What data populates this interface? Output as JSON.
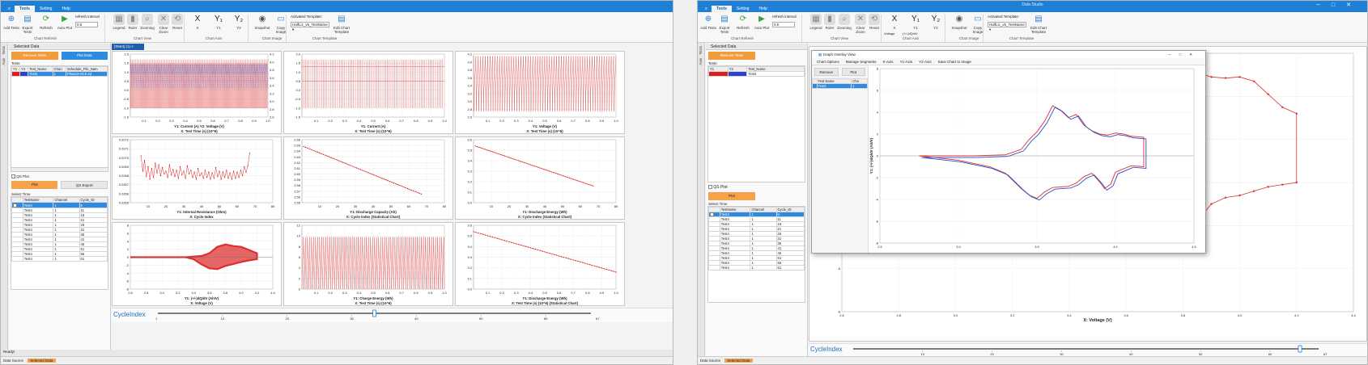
{
  "w1": {
    "file": "≡",
    "tabs": [
      "Tools",
      "Setting",
      "Help"
    ],
    "ribbon": {
      "buttons": [
        {
          "label": "Add Tests",
          "icon": "⊕",
          "color": "#2f7fd0"
        },
        {
          "label": "Export Tests",
          "icon": "▤",
          "color": "#2f7fd0"
        },
        {
          "label": "Refresh",
          "icon": "⟳",
          "color": "#3aa03a"
        },
        {
          "label": "Auto Plot",
          "icon": "▶",
          "color": "#3aa03a"
        },
        {
          "label": "Legend",
          "icon": "▦",
          "color": "#888"
        },
        {
          "label": "Ruler",
          "icon": "▮",
          "color": "#888"
        },
        {
          "label": "Zooming",
          "icon": "⌕",
          "color": "#888"
        },
        {
          "label": "Clear Zoom",
          "icon": "✕",
          "color": "#888"
        },
        {
          "label": "Reset",
          "icon": "⟲",
          "color": "#888"
        },
        {
          "label": "X",
          "icon": "X",
          "color": "#223"
        },
        {
          "label": "Y1",
          "icon": "Y₁",
          "color": "#223"
        },
        {
          "label": "Y2",
          "icon": "Y₂",
          "color": "#223"
        },
        {
          "label": "Snapshot",
          "icon": "◉",
          "color": "#555"
        },
        {
          "label": "Copy Image",
          "icon": "▭",
          "color": "#2f7fd0"
        },
        {
          "label": "Edit Chart Template",
          "icon": "▤",
          "color": "#2f7fd0"
        }
      ],
      "refresh_interval_label": "refresh interval",
      "refresh_interval_value": "0.5",
      "template_label": "Activated Template:",
      "template_value": "HalfLiz_v5_TestName",
      "groups": [
        "Chart Refresh",
        "Chart View",
        "Chart Axis",
        "Chart Image",
        "Chart Template"
      ]
    },
    "vtabs": [
      "Tests",
      "Axis"
    ],
    "selected_data": "Selected Data",
    "remove_tests": "Remove Tests",
    "plot_data": "Plot Data",
    "tests_label": "Tests",
    "tests_headers": [
      "Y1",
      "Y2",
      "Test_Name",
      "Chan",
      "Schedule_File_Nam"
    ],
    "tests_row": [
      "",
      "",
      "Test4",
      "1",
      "Phase3-HCK.sd"
    ],
    "qs_plot": "QS Plot",
    "plot": "Plot",
    "qs_export": "QS Export",
    "select_time": "Select Time",
    "cycle_headers": [
      "",
      "TestName",
      "Channel",
      "Cycle_ID"
    ],
    "cycle_rows": [
      [
        "Test4",
        "1",
        "6"
      ],
      [
        "Test4",
        "1",
        "11"
      ],
      [
        "Test4",
        "1",
        "16"
      ],
      [
        "Test4",
        "1",
        "21"
      ],
      [
        "Test4",
        "1",
        "26"
      ],
      [
        "Test4",
        "1",
        "31"
      ],
      [
        "Test4",
        "1",
        "36"
      ],
      [
        "Test4",
        "1",
        "41"
      ],
      [
        "Test4",
        "1",
        "46"
      ],
      [
        "Test4",
        "1",
        "51"
      ],
      [
        "Test4",
        "1",
        "56"
      ],
      [
        "Test4",
        "1",
        "61"
      ]
    ],
    "bottom_tabs": [
      "Data Source",
      "Selected Data"
    ],
    "status": "Ready!",
    "doc_tab": "[Test4] (1)",
    "cycle_index": "CycleIndex",
    "slider_min": "1",
    "slider_max": "67",
    "slider_ticks": [
      "10",
      "20",
      "30",
      "40",
      "50",
      "60"
    ]
  },
  "w2": {
    "title": "Data Studio",
    "tabs": [
      "Tools",
      "Setting",
      "Help"
    ],
    "voltage_label": "Voltage",
    "dqdv_label": "(+/-)dQ/dV",
    "overlay": {
      "title": "Graph Overlay View",
      "menu": [
        "Chart Options",
        "Manage Segments",
        "X-Axis",
        "Y1-Axis",
        "Y2-Axis",
        "Save Chart to Image"
      ],
      "remove": "Remove",
      "plot": "Plot",
      "headers": [
        "Test Name",
        "Cha"
      ],
      "row": [
        "Test4",
        "1"
      ]
    },
    "cycle_index": "CycleIndex",
    "slider_ticks": [
      "10",
      "20",
      "30",
      "40",
      "50",
      "60"
    ],
    "slider_end": "67",
    "status": "Ready!"
  },
  "colors": {
    "accent": "#1e7fd6",
    "orange": "#f5a24a",
    "series": "#d93030",
    "series2": "#2b4fc8",
    "selected": "#2d8be0"
  },
  "chart_data": [
    {
      "type": "line",
      "title": "",
      "xlabel": "X: Test Time (s) (10^6)",
      "ylabel": "Y1: Current (A)   Y2: Voltage (V)",
      "xlim": [
        0,
        1.0
      ],
      "ylim": [
        -1.5,
        2.0
      ],
      "y2lim": [
        2.6,
        4.2
      ],
      "xticks": [
        "0.1",
        "0.2",
        "0.3",
        "0.4",
        "0.5",
        "0.6",
        "0.7",
        "0.8",
        "0.9",
        "1.0"
      ],
      "yticks": [
        "2.0",
        "1.5",
        "1.0",
        "0.5",
        "0.0",
        "-0.5",
        "-1.0",
        "-1.5"
      ],
      "y2ticks": [
        "4.2",
        "4.0",
        "3.8",
        "3.6",
        "3.4",
        "3.2",
        "3.0",
        "2.8",
        "2.6"
      ]
    },
    {
      "type": "line",
      "title": "",
      "xlabel": "X: Test Time (s) (10^6)",
      "ylabel": "Y1: Current (A)",
      "xlim": [
        0,
        1.0
      ],
      "ylim": [
        -1.5,
        2.0
      ],
      "xticks": [
        "0.1",
        "0.2",
        "0.3",
        "0.4",
        "0.5",
        "0.6",
        "0.7",
        "0.8",
        "0.9",
        "1.0"
      ],
      "yticks": [
        "2.0",
        "1.5",
        "1.0",
        "0.5",
        "0.0",
        "-0.5",
        "-1.0",
        "-1.5"
      ]
    },
    {
      "type": "line",
      "title": "",
      "xlabel": "X: Test Time (s) (10^6)",
      "ylabel": "Y1: Voltage (V)",
      "xlim": [
        0,
        1.0
      ],
      "ylim": [
        2.6,
        4.2
      ],
      "xticks": [
        "0.1",
        "0.2",
        "0.3",
        "0.4",
        "0.5",
        "0.6",
        "0.7",
        "0.8",
        "0.9",
        "1.0"
      ],
      "yticks": [
        "4.2",
        "4.0",
        "3.8",
        "3.6",
        "3.4",
        "3.2",
        "3.0",
        "2.8",
        "2.6"
      ]
    },
    {
      "type": "line",
      "title": "",
      "xlabel": "X: Cycle Index",
      "ylabel": "Y1: Internal Resistance (Ohm)",
      "xlim": [
        0,
        80
      ],
      "ylim": [
        0.0265,
        0.0272
      ],
      "xticks": [
        "10",
        "20",
        "30",
        "40",
        "50",
        "60",
        "70",
        "80"
      ],
      "yticks": [
        "0.0272",
        "0.0271",
        "0.0270",
        "0.0269",
        "0.0268",
        "0.0267",
        "0.0266",
        "0.0265"
      ],
      "x": [
        6,
        7,
        8,
        9,
        10,
        11,
        12,
        13,
        14,
        15,
        16,
        17,
        18,
        19,
        20,
        21,
        22,
        23,
        24,
        25,
        26,
        27,
        28,
        29,
        30,
        31,
        32,
        33,
        34,
        35,
        36,
        37,
        38,
        39,
        40,
        41,
        42,
        43,
        44,
        45,
        46,
        47,
        48,
        49,
        50,
        51,
        52,
        53,
        54,
        55,
        56,
        57,
        58,
        59,
        60,
        61,
        62,
        63,
        64,
        65,
        66,
        67
      ],
      "values": [
        0.02702,
        0.02685,
        0.02697,
        0.02679,
        0.0269,
        0.02676,
        0.02688,
        0.02678,
        0.02694,
        0.02683,
        0.02692,
        0.0268,
        0.02689,
        0.02682,
        0.02685,
        0.02678,
        0.02692,
        0.02681,
        0.02687,
        0.02679,
        0.02686,
        0.02677,
        0.0269,
        0.02681,
        0.02685,
        0.02677,
        0.02691,
        0.02682,
        0.02686,
        0.02678,
        0.02684,
        0.02676,
        0.02688,
        0.0268,
        0.02683,
        0.02677,
        0.02686,
        0.02678,
        0.02684,
        0.02676,
        0.02683,
        0.02677,
        0.02689,
        0.02679,
        0.02685,
        0.02676,
        0.02684,
        0.02678,
        0.02686,
        0.02677,
        0.02683,
        0.02676,
        0.02685,
        0.02677,
        0.02684,
        0.02678,
        0.02686,
        0.0268,
        0.0269,
        0.02684,
        0.02691,
        0.02705
      ]
    },
    {
      "type": "line",
      "title": "",
      "xlabel": "X: Cycle Index (Statistical Chart)",
      "ylabel": "Y1: Discharge Capacity (Ah)",
      "xlim": [
        0,
        80
      ],
      "ylim": [
        2.55,
        2.66
      ],
      "xticks": [
        "10",
        "20",
        "30",
        "40",
        "50",
        "60",
        "70",
        "80"
      ],
      "yticks": [
        "2.66",
        "2.65",
        "2.64",
        "2.63",
        "2.62",
        "2.61",
        "2.60",
        "2.59",
        "2.58",
        "2.57",
        "2.56",
        "2.55"
      ],
      "x": [
        1,
        67
      ],
      "values": [
        2.648,
        2.565
      ]
    },
    {
      "type": "line",
      "title": "",
      "xlabel": "X: Cycle Index (Statistical Chart)",
      "ylabel": "Y1: Discharge Energy (Wh)",
      "xlim": [
        0,
        80
      ],
      "ylim": [
        9.0,
        9.6
      ],
      "xticks": [
        "10",
        "20",
        "30",
        "40",
        "50",
        "60",
        "70",
        "80"
      ],
      "yticks": [
        "9.6",
        "9.5",
        "9.4",
        "9.3",
        "9.2",
        "9.1",
        "9.0"
      ],
      "x": [
        1,
        67
      ],
      "values": [
        9.54,
        9.16
      ]
    },
    {
      "type": "line",
      "title": "",
      "xlabel": "X: Voltage (V)",
      "ylabel": "Y1: (+/-)dQ/dV (Ah/V)",
      "xlim": [
        2.6,
        4.4
      ],
      "ylim": [
        -8,
        8
      ],
      "xticks": [
        "2.6",
        "2.8",
        "3.0",
        "3.2",
        "3.4",
        "3.6",
        "3.8",
        "4.0",
        "4.2",
        "4.4"
      ],
      "yticks": [
        "8",
        "6",
        "4",
        "2",
        "0",
        "-2",
        "-4",
        "-6",
        "-8"
      ]
    },
    {
      "type": "line",
      "title": "",
      "xlabel": "X: Test Time (s) (10^6)",
      "ylabel": "Y1: Charge Energy (Wh)",
      "xlim": [
        0,
        1.0
      ],
      "ylim": [
        0,
        12
      ],
      "xticks": [
        "0.1",
        "0.2",
        "0.3",
        "0.4",
        "0.5",
        "0.6",
        "0.7",
        "0.8",
        "0.9",
        "1.0"
      ],
      "yticks": [
        "12",
        "10",
        "8",
        "6",
        "4",
        "2",
        "0"
      ]
    },
    {
      "type": "line",
      "title": "",
      "xlabel": "X: Test Time (s) (10^6) (Statistical Chart)",
      "ylabel": "Y1: Discharge Energy (Wh)",
      "xlim": [
        0,
        1.0
      ],
      "ylim": [
        9.0,
        9.6
      ],
      "xticks": [
        "0.1",
        "0.2",
        "0.3",
        "0.4",
        "0.5",
        "0.6",
        "0.7",
        "0.8",
        "0.9",
        "1.0"
      ],
      "yticks": [
        "9.6",
        "9.5",
        "9.4",
        "9.3",
        "9.2",
        "9.1",
        "9.0"
      ],
      "x": [
        0.0,
        1.0
      ],
      "values": [
        9.54,
        9.16
      ]
    },
    {
      "type": "line",
      "title": "",
      "xlabel": "X: Voltage (V)",
      "ylabel": "",
      "xlim": [
        2.6,
        4.4
      ],
      "ylim": [
        -8,
        4
      ],
      "xticks": [
        "2.6",
        "2.8",
        "3.0",
        "3.2",
        "3.4",
        "3.6",
        "3.8",
        "4.0",
        "4.2",
        "4.4"
      ],
      "yticks": [
        "4",
        "2",
        "0",
        "-2",
        "-4",
        "-6",
        "-8"
      ],
      "x": [
        3.8,
        3.85,
        3.9,
        3.95,
        4.0,
        4.05,
        4.1,
        4.15,
        4.2,
        4.2,
        4.15,
        4.1,
        4.05,
        4.0,
        3.95,
        3.9,
        3.85,
        3.8,
        3.75,
        3.7,
        3.65,
        3.6
      ],
      "values": [
        3.3,
        3.1,
        2.9,
        2.85,
        2.9,
        2.7,
        2.1,
        1.5,
        1.2,
        -2.0,
        -2.1,
        -2.2,
        -2.4,
        -2.6,
        -2.7,
        -3.0,
        -3.8,
        -4.2,
        -3.2,
        -2.7,
        -2.9,
        -3.2
      ]
    },
    {
      "type": "line",
      "title": "",
      "xlabel": "",
      "ylabel": "Y1: (+/-)dQ/dV (Ah/V)",
      "xlim": [
        2.5,
        4.5
      ],
      "ylim": [
        -8,
        8
      ],
      "xticks": [
        "2.5",
        "3.0",
        "3.5",
        "4.0",
        "4.5"
      ],
      "yticks": [
        "8",
        "6",
        "4",
        "2",
        "0",
        "-2",
        "-4",
        "-6",
        "-8"
      ],
      "series": [
        {
          "values": []
        },
        {
          "values": []
        }
      ]
    }
  ]
}
